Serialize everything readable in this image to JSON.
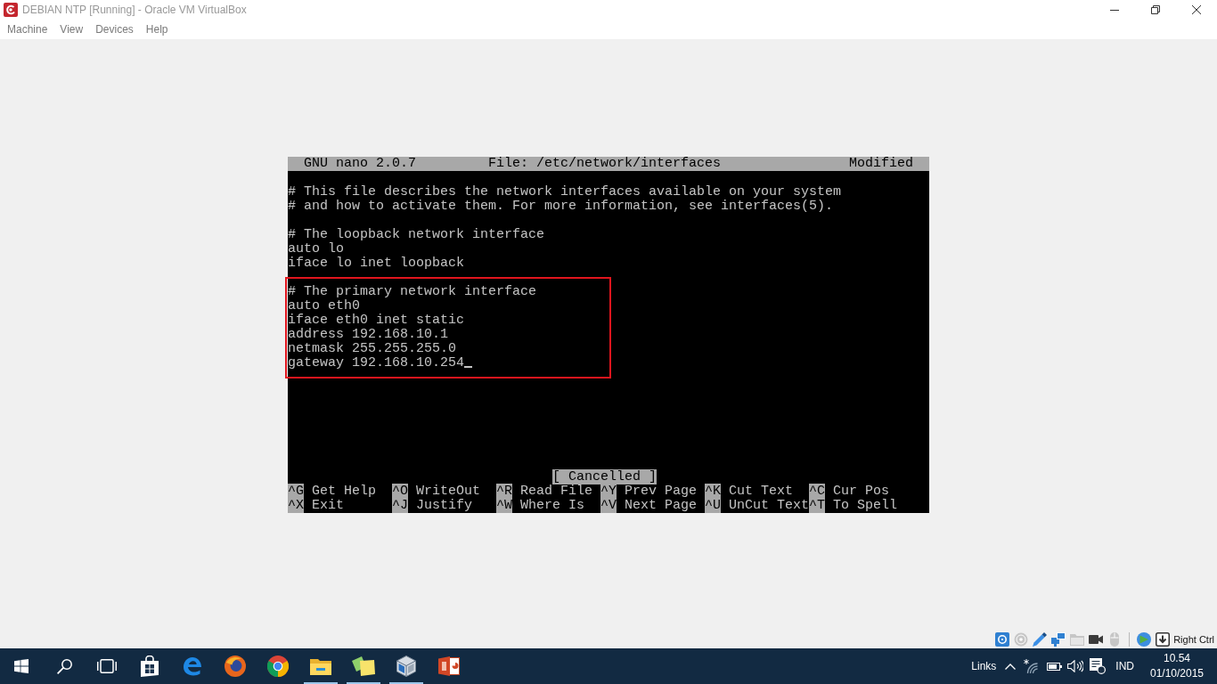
{
  "window": {
    "title": "DEBIAN NTP [Running] - Oracle VM VirtualBox"
  },
  "menu": [
    "Machine",
    "View",
    "Devices",
    "Help"
  ],
  "nano": {
    "title_bar": {
      "version": "GNU nano 2.0.7",
      "file": "File: /etc/network/interfaces",
      "state": "Modified"
    },
    "buffer": [
      {
        "lines": [
          "# This file describes the network interfaces available on your system",
          "# and how to activate them. For more information, see interfaces(5)."
        ],
        "highlighted": false,
        "cursor": false
      },
      {
        "lines": [
          "# The loopback network interface",
          "auto lo",
          "iface lo inet loopback"
        ],
        "highlighted": false,
        "cursor": false
      },
      {
        "lines": [
          "# The primary network interface",
          "auto eth0",
          "iface eth0 inet static",
          "address 192.168.10.1",
          "netmask 255.255.255.0",
          "gateway 192.168.10.254"
        ],
        "highlighted": true,
        "cursor": true
      }
    ],
    "message": "[ Cancelled ]",
    "shortcuts": [
      {
        "key": "^G",
        "label": "Get Help"
      },
      {
        "key": "^O",
        "label": "WriteOut"
      },
      {
        "key": "^R",
        "label": "Read File"
      },
      {
        "key": "^Y",
        "label": "Prev Page"
      },
      {
        "key": "^K",
        "label": "Cut Text"
      },
      {
        "key": "^C",
        "label": "Cur Pos"
      },
      {
        "key": "^X",
        "label": "Exit"
      },
      {
        "key": "^J",
        "label": "Justify"
      },
      {
        "key": "^W",
        "label": "Where Is"
      },
      {
        "key": "^V",
        "label": "Next Page"
      },
      {
        "key": "^U",
        "label": "UnCut Text"
      },
      {
        "key": "^T",
        "label": "To Spell"
      }
    ]
  },
  "status_bar": {
    "devices": [
      {
        "kind": "disk",
        "active": true
      },
      {
        "kind": "optical",
        "active": false
      },
      {
        "kind": "usb",
        "active": true
      },
      {
        "kind": "network",
        "active": true
      },
      {
        "kind": "folder",
        "active": false
      },
      {
        "kind": "capture",
        "active": true
      },
      {
        "kind": "mouse",
        "active": false
      }
    ],
    "input": [
      {
        "kind": "globe",
        "active": true
      },
      {
        "kind": "keyboard",
        "active": true
      }
    ],
    "host_key": "Right Ctrl"
  },
  "taskbar": {
    "items": [
      {
        "kind": "start",
        "running": false
      },
      {
        "kind": "search",
        "running": false
      },
      {
        "kind": "taskview",
        "running": false
      },
      {
        "kind": "store",
        "running": false
      },
      {
        "kind": "edge",
        "running": false
      },
      {
        "kind": "firefox",
        "running": false
      },
      {
        "kind": "chrome",
        "running": false
      },
      {
        "kind": "explorer",
        "running": true
      },
      {
        "kind": "notes",
        "running": true
      },
      {
        "kind": "virtualbox",
        "running": true
      },
      {
        "kind": "powerpoint",
        "running": false
      }
    ],
    "tray": {
      "toolbar": "Links",
      "language": "IND",
      "time": "10.54",
      "date": "01/10/2015"
    }
  }
}
